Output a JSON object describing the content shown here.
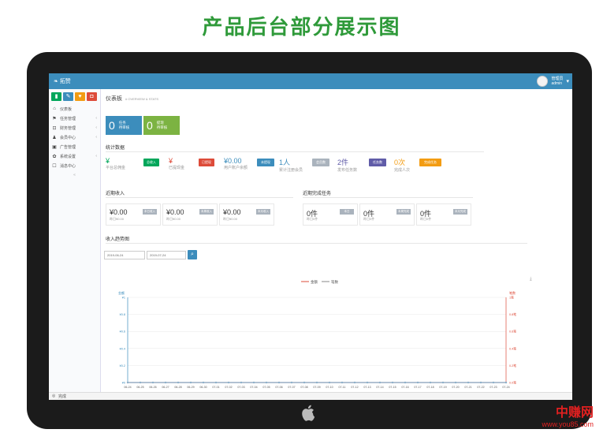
{
  "page_title": "产品后台部分展示图",
  "app": {
    "brand": "拓赞",
    "user_name": "管理员",
    "user_sub": "admin"
  },
  "sidebar": {
    "items": [
      {
        "icon": "home-icon",
        "glyph": "⌂",
        "label": "仪表板",
        "chev": ""
      },
      {
        "icon": "flag-icon",
        "glyph": "⚑",
        "label": "任务管理",
        "chev": "‹"
      },
      {
        "icon": "lock-icon",
        "glyph": "⊡",
        "label": "财务管理",
        "chev": "‹"
      },
      {
        "icon": "user-icon",
        "glyph": "♟",
        "label": "会员中心",
        "chev": "‹"
      },
      {
        "icon": "image-icon",
        "glyph": "▣",
        "label": "广告管理",
        "chev": ""
      },
      {
        "icon": "gear-icon",
        "glyph": "✿",
        "label": "系统设置",
        "chev": "‹"
      },
      {
        "icon": "message-icon",
        "glyph": "☐",
        "label": "消息中心",
        "chev": ""
      }
    ]
  },
  "header": {
    "title": "仪表板",
    "sub": "# OVERVIEW & STATS"
  },
  "kpis": [
    {
      "num": "0",
      "title": "任务",
      "sub": "待审核"
    },
    {
      "num": "0",
      "title": "提现",
      "sub": "待审核"
    }
  ],
  "sections": {
    "stats": "统计数据",
    "income": "近期收入",
    "tasks": "近期完成任务",
    "trend": "收入趋势图"
  },
  "stats": [
    {
      "value": "¥",
      "sub": "平台总佣金",
      "tag": "总收入",
      "tag_color": "#00a65a"
    },
    {
      "value": "¥",
      "sub": "已提现金",
      "tag": "已提现",
      "tag_color": "#dd4b39"
    },
    {
      "value": "¥0.00",
      "sub": "用户账户余额",
      "tag": "未提现",
      "tag_color": "#3c8dbc"
    },
    {
      "value": "1人",
      "sub": "累计注册会员",
      "tag": "会员数",
      "tag_color": "#aab3bd"
    },
    {
      "value": "2件",
      "sub": "发布任务数",
      "tag": "任务数",
      "tag_color": "#605ca8"
    },
    {
      "value": "0次",
      "sub": "完成人次",
      "tag": "完成任务",
      "tag_color": "#f39c12"
    }
  ],
  "income_cards": [
    {
      "value": "¥0.00",
      "sub": "昨日¥0.00",
      "btn": "本日收入"
    },
    {
      "value": "¥0.00",
      "sub": "昨日¥0.00",
      "btn": "本周收入"
    },
    {
      "value": "¥0.00",
      "sub": "昨日¥0.00",
      "btn": "本月收入"
    }
  ],
  "task_cards": [
    {
      "value": "0件",
      "sub": "昨日0件",
      "btn": "本日"
    },
    {
      "value": "0件",
      "sub": "昨日0件",
      "btn": "本周完成"
    },
    {
      "value": "0件",
      "sub": "昨日0件",
      "btn": "本月完成"
    }
  ],
  "date_range": {
    "start": "2019-06-24",
    "end": "2019-07-24"
  },
  "chart_data": {
    "type": "line",
    "title": "",
    "legend": [
      "金额",
      "笔数"
    ],
    "ylabel": "金额",
    "y2label": "笔数",
    "ylim": [
      0,
      1
    ],
    "y2lim": [
      0,
      1
    ],
    "yticks": [
      "¥1",
      "¥0.8",
      "¥0.6",
      "¥0.4",
      "¥0.2",
      "¥0"
    ],
    "y2ticks": [
      "1笔",
      "0.8笔",
      "0.6笔",
      "0.4笔",
      "0.2笔",
      "0.0笔"
    ],
    "categories": [
      "06-24",
      "06-25",
      "06-26",
      "06-27",
      "06-28",
      "06-29",
      "06-30",
      "07-01",
      "07-02",
      "07-03",
      "07-04",
      "07-05",
      "07-06",
      "07-07",
      "07-08",
      "07-09",
      "07-10",
      "07-11",
      "07-12",
      "07-13",
      "07-14",
      "07-15",
      "07-16",
      "07-17",
      "07-18",
      "07-19",
      "07-20",
      "07-21",
      "07-22",
      "07-23",
      "07-24"
    ],
    "series": [
      {
        "name": "金额",
        "values": [
          0,
          0,
          0,
          0,
          0,
          0,
          0,
          0,
          0,
          0,
          0,
          0,
          0,
          0,
          0,
          0,
          0,
          0,
          0,
          0,
          0,
          0,
          0,
          0,
          0,
          0,
          0,
          0,
          0,
          0,
          0
        ]
      },
      {
        "name": "笔数",
        "values": [
          0,
          0,
          0,
          0,
          0,
          0,
          0,
          0,
          0,
          0,
          0,
          0,
          0,
          0,
          0,
          0,
          0,
          0,
          0,
          0,
          0,
          0,
          0,
          0,
          0,
          0,
          0,
          0,
          0,
          0,
          0
        ]
      }
    ],
    "grid": true,
    "legend_position": "top"
  },
  "statusbar": {
    "text": "完成"
  },
  "watermark": {
    "line1": "中赚网",
    "line2": "www.you85.com"
  }
}
